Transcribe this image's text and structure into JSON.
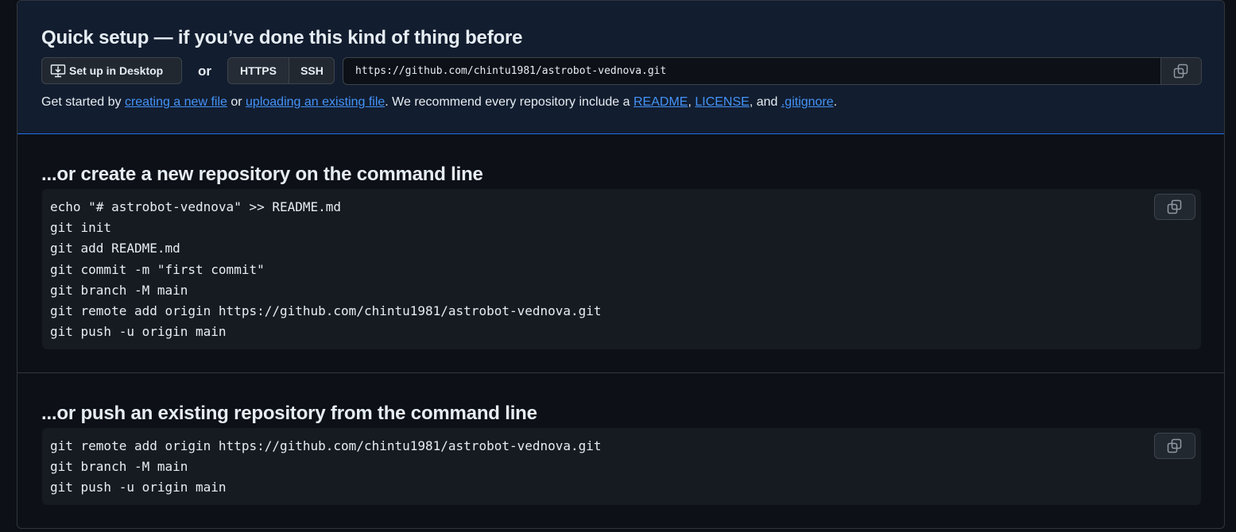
{
  "quick_setup": {
    "title": "Quick setup — if you’ve done this kind of thing before",
    "desktop_button": "Set up in Desktop",
    "or_label": "or",
    "protocols": [
      "HTTPS",
      "SSH"
    ],
    "selected_protocol": "HTTPS",
    "clone_url": "https://github.com/chintu1981/astrobot-vednova.git",
    "get_started": {
      "prefix": "Get started by ",
      "link_new_file": "creating a new file",
      "middle": " or ",
      "link_upload": "uploading an existing file",
      "recommend": ". We recommend every repository include a ",
      "link_readme": "README",
      "comma": ", ",
      "link_license": "LICENSE",
      "and": ", and ",
      "link_gitignore": ".gitignore",
      "end": "."
    }
  },
  "create_section": {
    "title": "...or create a new repository on the command line",
    "lines": [
      "echo \"# astrobot-vednova\" >> README.md",
      "git init",
      "git add README.md",
      "git commit -m \"first commit\"",
      "git branch -M main",
      "git remote add origin https://github.com/chintu1981/astrobot-vednova.git",
      "git push -u origin main"
    ]
  },
  "push_section": {
    "title": "...or push an existing repository from the command line",
    "lines": [
      "git remote add origin https://github.com/chintu1981/astrobot-vednova.git",
      "git branch -M main",
      "git push -u origin main"
    ]
  },
  "icons": {
    "desktop": "desktop-download-icon",
    "copy": "copy-icon"
  },
  "colors": {
    "background": "#0d1117",
    "quick_setup_bg": "#121d2f",
    "link": "#4493f8",
    "border": "#30363d",
    "code_bg": "#161b22"
  }
}
